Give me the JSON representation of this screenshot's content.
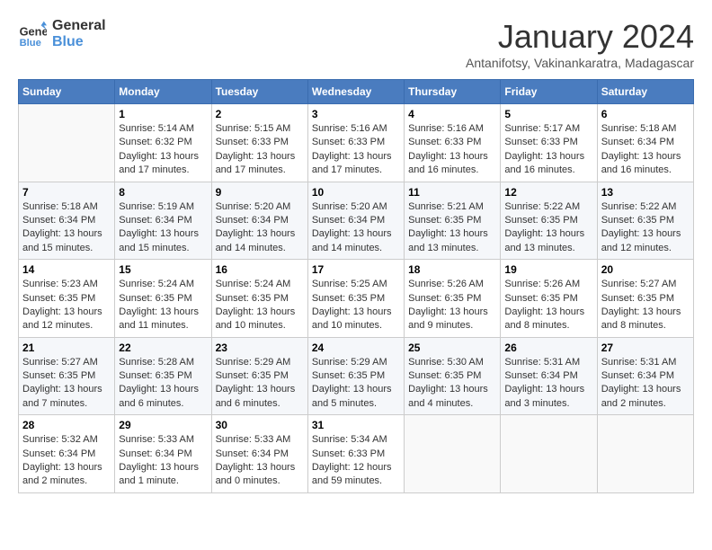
{
  "logo": {
    "line1": "General",
    "line2": "Blue"
  },
  "title": "January 2024",
  "subtitle": "Antanifotsy, Vakinankaratra, Madagascar",
  "days_header": [
    "Sunday",
    "Monday",
    "Tuesday",
    "Wednesday",
    "Thursday",
    "Friday",
    "Saturday"
  ],
  "weeks": [
    [
      {
        "day": "",
        "info": ""
      },
      {
        "day": "1",
        "info": "Sunrise: 5:14 AM\nSunset: 6:32 PM\nDaylight: 13 hours\nand 17 minutes."
      },
      {
        "day": "2",
        "info": "Sunrise: 5:15 AM\nSunset: 6:33 PM\nDaylight: 13 hours\nand 17 minutes."
      },
      {
        "day": "3",
        "info": "Sunrise: 5:16 AM\nSunset: 6:33 PM\nDaylight: 13 hours\nand 17 minutes."
      },
      {
        "day": "4",
        "info": "Sunrise: 5:16 AM\nSunset: 6:33 PM\nDaylight: 13 hours\nand 16 minutes."
      },
      {
        "day": "5",
        "info": "Sunrise: 5:17 AM\nSunset: 6:33 PM\nDaylight: 13 hours\nand 16 minutes."
      },
      {
        "day": "6",
        "info": "Sunrise: 5:18 AM\nSunset: 6:34 PM\nDaylight: 13 hours\nand 16 minutes."
      }
    ],
    [
      {
        "day": "7",
        "info": "Sunrise: 5:18 AM\nSunset: 6:34 PM\nDaylight: 13 hours\nand 15 minutes."
      },
      {
        "day": "8",
        "info": "Sunrise: 5:19 AM\nSunset: 6:34 PM\nDaylight: 13 hours\nand 15 minutes."
      },
      {
        "day": "9",
        "info": "Sunrise: 5:20 AM\nSunset: 6:34 PM\nDaylight: 13 hours\nand 14 minutes."
      },
      {
        "day": "10",
        "info": "Sunrise: 5:20 AM\nSunset: 6:34 PM\nDaylight: 13 hours\nand 14 minutes."
      },
      {
        "day": "11",
        "info": "Sunrise: 5:21 AM\nSunset: 6:35 PM\nDaylight: 13 hours\nand 13 minutes."
      },
      {
        "day": "12",
        "info": "Sunrise: 5:22 AM\nSunset: 6:35 PM\nDaylight: 13 hours\nand 13 minutes."
      },
      {
        "day": "13",
        "info": "Sunrise: 5:22 AM\nSunset: 6:35 PM\nDaylight: 13 hours\nand 12 minutes."
      }
    ],
    [
      {
        "day": "14",
        "info": "Sunrise: 5:23 AM\nSunset: 6:35 PM\nDaylight: 13 hours\nand 12 minutes."
      },
      {
        "day": "15",
        "info": "Sunrise: 5:24 AM\nSunset: 6:35 PM\nDaylight: 13 hours\nand 11 minutes."
      },
      {
        "day": "16",
        "info": "Sunrise: 5:24 AM\nSunset: 6:35 PM\nDaylight: 13 hours\nand 10 minutes."
      },
      {
        "day": "17",
        "info": "Sunrise: 5:25 AM\nSunset: 6:35 PM\nDaylight: 13 hours\nand 10 minutes."
      },
      {
        "day": "18",
        "info": "Sunrise: 5:26 AM\nSunset: 6:35 PM\nDaylight: 13 hours\nand 9 minutes."
      },
      {
        "day": "19",
        "info": "Sunrise: 5:26 AM\nSunset: 6:35 PM\nDaylight: 13 hours\nand 8 minutes."
      },
      {
        "day": "20",
        "info": "Sunrise: 5:27 AM\nSunset: 6:35 PM\nDaylight: 13 hours\nand 8 minutes."
      }
    ],
    [
      {
        "day": "21",
        "info": "Sunrise: 5:27 AM\nSunset: 6:35 PM\nDaylight: 13 hours\nand 7 minutes."
      },
      {
        "day": "22",
        "info": "Sunrise: 5:28 AM\nSunset: 6:35 PM\nDaylight: 13 hours\nand 6 minutes."
      },
      {
        "day": "23",
        "info": "Sunrise: 5:29 AM\nSunset: 6:35 PM\nDaylight: 13 hours\nand 6 minutes."
      },
      {
        "day": "24",
        "info": "Sunrise: 5:29 AM\nSunset: 6:35 PM\nDaylight: 13 hours\nand 5 minutes."
      },
      {
        "day": "25",
        "info": "Sunrise: 5:30 AM\nSunset: 6:35 PM\nDaylight: 13 hours\nand 4 minutes."
      },
      {
        "day": "26",
        "info": "Sunrise: 5:31 AM\nSunset: 6:34 PM\nDaylight: 13 hours\nand 3 minutes."
      },
      {
        "day": "27",
        "info": "Sunrise: 5:31 AM\nSunset: 6:34 PM\nDaylight: 13 hours\nand 2 minutes."
      }
    ],
    [
      {
        "day": "28",
        "info": "Sunrise: 5:32 AM\nSunset: 6:34 PM\nDaylight: 13 hours\nand 2 minutes."
      },
      {
        "day": "29",
        "info": "Sunrise: 5:33 AM\nSunset: 6:34 PM\nDaylight: 13 hours\nand 1 minute."
      },
      {
        "day": "30",
        "info": "Sunrise: 5:33 AM\nSunset: 6:34 PM\nDaylight: 13 hours\nand 0 minutes."
      },
      {
        "day": "31",
        "info": "Sunrise: 5:34 AM\nSunset: 6:33 PM\nDaylight: 12 hours\nand 59 minutes."
      },
      {
        "day": "",
        "info": ""
      },
      {
        "day": "",
        "info": ""
      },
      {
        "day": "",
        "info": ""
      }
    ]
  ]
}
